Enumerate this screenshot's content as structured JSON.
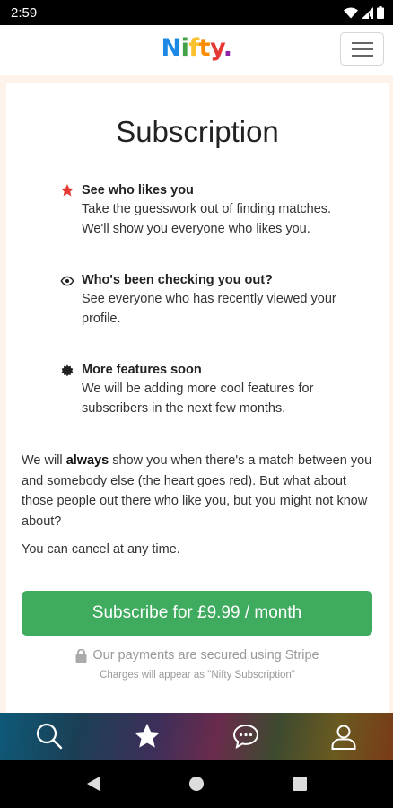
{
  "status_bar": {
    "time": "2:59"
  },
  "header": {
    "logo_letters": [
      "N",
      "i",
      "f",
      "t",
      "y",
      "."
    ],
    "menu_icon": "hamburger-icon"
  },
  "page": {
    "title": "Subscription",
    "features": [
      {
        "icon": "star-icon",
        "icon_color": "#e53935",
        "title": "See who likes you",
        "lines": [
          "Take the guesswork out of finding matches.",
          "We'll show you everyone who likes you."
        ]
      },
      {
        "icon": "eye-icon",
        "icon_color": "#222222",
        "title": "Who's been checking you out?",
        "lines": [
          "See everyone who has recently viewed your",
          "profile."
        ]
      },
      {
        "icon": "gear-icon",
        "icon_color": "#222222",
        "title": "More features soon",
        "lines": [
          "We will be adding more cool features for",
          "subscribers in the next few months."
        ]
      }
    ],
    "paragraph_pre": "We will ",
    "paragraph_bold": "always",
    "paragraph_post": " show you when there's a match between you and somebody else (the heart goes red). But what about those people out there who like you, but you might not know about?",
    "cancel_text": "You can cancel at any time.",
    "subscribe_label": "Subscribe for £9.99 / month",
    "secure_text": "Our payments are secured using Stripe",
    "charges_text": "Charges will appear as \"Nifty Subscription\""
  },
  "bottom_nav": {
    "items": [
      "search-icon",
      "star-icon",
      "chat-icon",
      "profile-icon"
    ],
    "active": "star-icon"
  },
  "colors": {
    "accent_green": "#3fab5f",
    "background": "#fdf3ea"
  }
}
